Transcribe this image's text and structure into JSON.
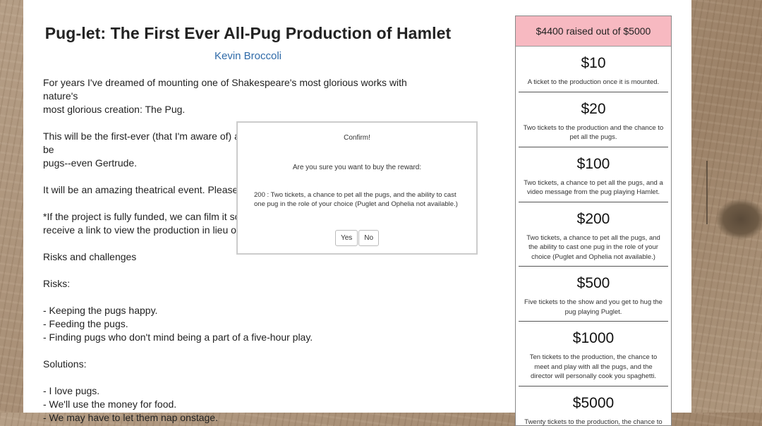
{
  "project": {
    "title": "Pug-let: The First Ever All-Pug Production of Hamlet",
    "author": "Kevin Broccoli"
  },
  "story": {
    "p1": "For years I've dreamed of mounting one of Shakespeare's most glorious works with nature's\nmost glorious creation:  The Pug.",
    "p2": "This will be the first-ever (that I'm aware of) all-pug production of 'Hamlet.' The actors will be\npugs--even Gertrude.",
    "p3": "It will be an amazing theatrical event.  Please help us bring it",
    "p4": "*If the project is fully funded, we can film it so people who can't see it live will\nreceive a link to view the production in lieu of  tickets.",
    "p5": "Risks and challenges",
    "p6": "Risks:",
    "p7": "- Keeping the pugs happy.\n- Feeding the pugs.\n- Finding pugs who don't mind being a part of a five-hour play.",
    "p8": "Solutions:",
    "p9": "- I love pugs.\n- We'll use the money for food.\n- We may have to let them nap onstage."
  },
  "funding": {
    "raised_text": "$4400 raised out of $5000"
  },
  "rewards": [
    {
      "amount": "$10",
      "desc": "A ticket to the production once it is mounted."
    },
    {
      "amount": "$20",
      "desc": "Two tickets to the production and the chance to pet all the pugs."
    },
    {
      "amount": "$100",
      "desc": "Two tickets, a chance to pet all the pugs, and a video message from the pug playing Hamlet."
    },
    {
      "amount": "$200",
      "desc": "Two tickets, a chance to pet all the pugs, and the ability to cast one pug in the role of your choice (Puglet and Ophelia not available.)"
    },
    {
      "amount": "$500",
      "desc": "Five tickets to the show and you get to hug the pug playing Puglet."
    },
    {
      "amount": "$1000",
      "desc": "Ten tickets to the production, the chance to meet and play with all the pugs, and the director will personally cook you spaghetti."
    },
    {
      "amount": "$5000",
      "desc": "Twenty tickets to the production, the chance to"
    }
  ],
  "dialog": {
    "title": "Confirm!",
    "question": "Are you sure you want to buy the reward:",
    "detail": "200 : Two tickets, a chance to pet all the pugs, and the ability to cast one pug in the role of your choice (Puglet and Ophelia not available.)",
    "yes_label": "Yes",
    "no_label": "No"
  }
}
